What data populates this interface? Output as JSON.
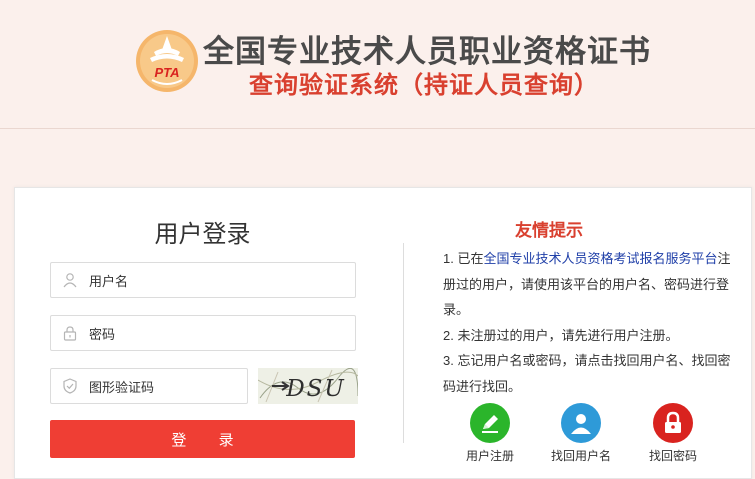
{
  "header": {
    "logo_text": "PTA",
    "title": "全国专业技术人员职业资格证书",
    "subtitle": "查询验证系统（持证人员查询）"
  },
  "login": {
    "title": "用户登录",
    "username_placeholder": "用户名",
    "password_placeholder": "密码",
    "captcha_placeholder": "图形验证码",
    "captcha_text": "DSU",
    "login_button": "登 录"
  },
  "tips": {
    "title": "友情提示",
    "item1_prefix": "1. 已在",
    "item1_link": "全国专业技术人员资格考试报名服务平台",
    "item1_suffix": "注册过的用户，请使用该平台的用户名、密码进行登录。",
    "item2": "2. 未注册过的用户，请先进行用户注册。",
    "item3": "3. 忘记用户名或密码，请点击找回用户名、找回密码进行找回。"
  },
  "actions": [
    {
      "label": "用户注册",
      "icon": "pencil-icon",
      "color": "#2bb52b"
    },
    {
      "label": "找回用户名",
      "icon": "user-icon",
      "color": "#2e9ad8"
    },
    {
      "label": "找回密码",
      "icon": "lock-icon",
      "color": "#d9231f"
    }
  ],
  "colors": {
    "background": "#fbf0ec",
    "accent_red": "#ef3e34",
    "title_red": "#d9402f",
    "link_blue": "#1f3fa8"
  }
}
